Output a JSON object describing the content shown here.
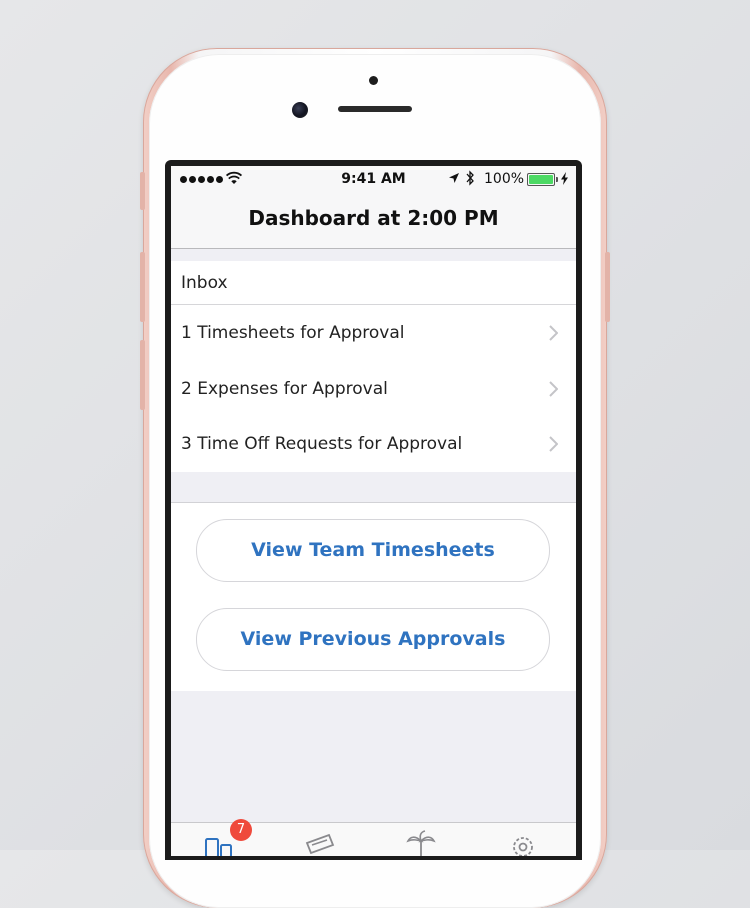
{
  "status_bar": {
    "time": "9:41 AM",
    "battery_percent": "100%",
    "battery_level": 1.0,
    "battery_color": "#4cd964"
  },
  "navbar": {
    "title": "Dashboard at 2:00 PM"
  },
  "inbox": {
    "header": "Inbox",
    "items": [
      {
        "label": "1 Timesheets for Approval"
      },
      {
        "label": "2 Expenses for Approval"
      },
      {
        "label": "3 Time Off Requests for Approval"
      }
    ]
  },
  "actions": {
    "view_team_timesheets": "View Team Timesheets",
    "view_previous_approvals": "View Previous Approvals"
  },
  "tabbar": {
    "dashboard_badge": "7",
    "tabs": [
      "dashboard-icon",
      "expenses-icon",
      "time-off-icon",
      "settings-icon"
    ]
  },
  "colors": {
    "accent": "#2f73c0",
    "badge": "#ef4a3c",
    "phone_frame": "#e8b7ad"
  }
}
